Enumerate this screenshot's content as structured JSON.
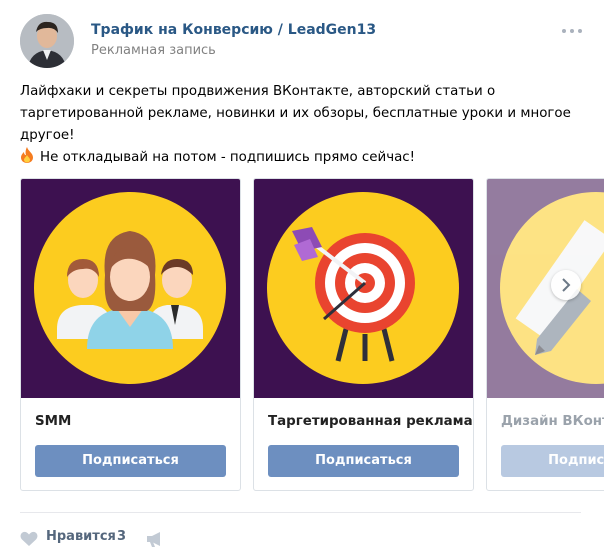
{
  "post": {
    "author": "Трафик на Конверсию / LeadGen13",
    "subtitle": "Рекламная запись",
    "text_line1": "Лайфхаки и секреты продвижения ВКонтакте, авторский статьи о",
    "text_line2": "таргетированной рекламе, новинки и их обзоры, бесплатные уроки и многое",
    "text_line3": "другое!",
    "text_line4": "Не откладывай на потом - подпишись прямо сейчас!",
    "more_icon": "ellipsis-icon",
    "fire_icon": "fire-emoji-icon"
  },
  "carousel": {
    "cards": [
      {
        "title": "SMM",
        "button": "Подписаться",
        "image": "team-people-icon"
      },
      {
        "title": "Таргетированная реклама",
        "button": "Подписаться",
        "image": "target-arrow-icon"
      },
      {
        "title": "Дизайн ВКонтакте",
        "button": "Подписаться",
        "image": "pencil-ruler-icon"
      }
    ],
    "next_icon": "chevron-right-icon"
  },
  "footer": {
    "like_label": "Нравится",
    "like_count": "3",
    "like_icon": "heart-icon",
    "share_icon": "megaphone-icon"
  },
  "colors": {
    "link": "#2a5885",
    "button": "#6d8fc0",
    "card_bg": "#3d1150",
    "circle": "#fccc1f"
  }
}
